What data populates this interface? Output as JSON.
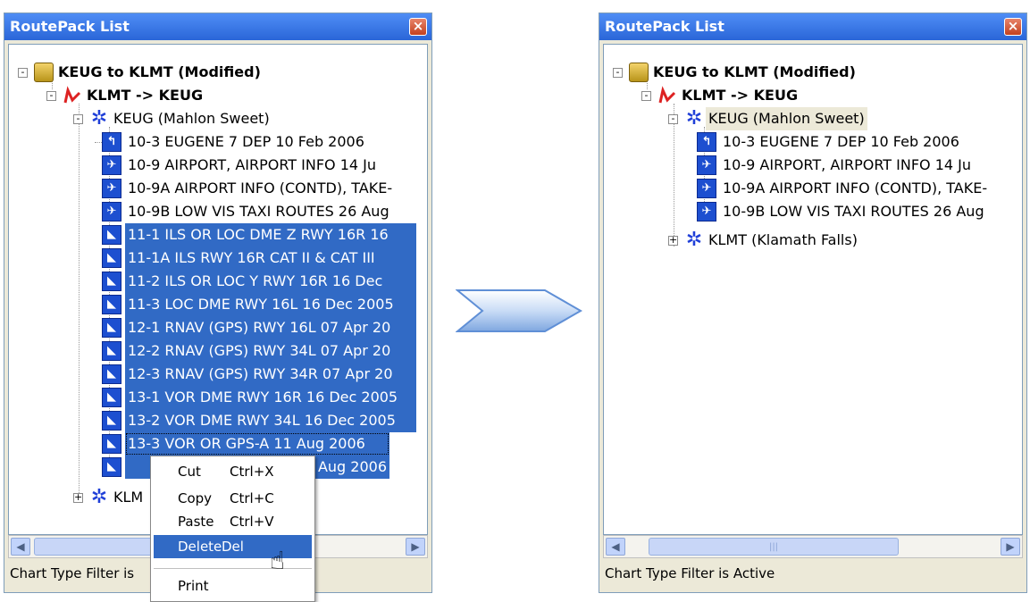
{
  "left_panel": {
    "title": "RoutePack List",
    "status": "Chart Type Filter is",
    "tree": {
      "root": "KEUG to KLMT (Modified)",
      "route": "KLMT -> KEUG",
      "airport1": "KEUG (Mahlon Sweet)",
      "airport2": "KLM",
      "charts": [
        "10-3  EUGENE 7 DEP   10 Feb 2006",
        "10-9  AIRPORT, AIRPORT INFO   14 Ju",
        "10-9A  AIRPORT INFO (CONTD), TAKE-",
        "10-9B  LOW VIS TAXI ROUTES   26 Aug",
        "11-1  ILS OR LOC DME Z RWY 16R   16",
        "11-1A  ILS RWY 16R CAT II & CAT III",
        "11-2  ILS OR LOC Y RWY 16R   16 Dec",
        "11-3  LOC DME RWY 16L   16 Dec 2005",
        "12-1  RNAV (GPS) RWY 16L   07 Apr 20",
        "12-2  RNAV (GPS) RWY 34L   07 Apr 20",
        "12-3  RNAV (GPS) RWY 34R   07 Apr 20",
        "13-1  VOR DME RWY 16R   16 Dec 2005",
        "13-2  VOR DME RWY 34L   16 Dec 2005",
        "13-3  VOR OR GPS-A   11 Aug 2006",
        "1 Aug 2006"
      ]
    }
  },
  "context_menu": {
    "items": [
      {
        "label": "Cut",
        "shortcut": "Ctrl+X"
      },
      {
        "label": "Copy",
        "shortcut": "Ctrl+C"
      },
      {
        "label": "Paste",
        "shortcut": "Ctrl+V"
      },
      {
        "label": "Delete",
        "shortcut": "Del"
      },
      {
        "label": "Print",
        "shortcut": ""
      }
    ]
  },
  "right_panel": {
    "title": "RoutePack List",
    "status": "Chart Type Filter is Active",
    "tree": {
      "root": "KEUG to KLMT (Modified)",
      "route": "KLMT -> KEUG",
      "airport1": "KEUG (Mahlon Sweet)",
      "airport2": "KLMT (Klamath Falls)",
      "charts": [
        "10-3  EUGENE 7 DEP   10 Feb 2006",
        "10-9  AIRPORT, AIRPORT INFO   14 Ju",
        "10-9A  AIRPORT INFO (CONTD), TAKE-",
        "10-9B  LOW VIS TAXI ROUTES   26 Aug"
      ]
    }
  },
  "icons": {
    "close": "close-icon",
    "routepack": "routepack-icon",
    "route": "route-icon",
    "airport": "gear-icon",
    "departure": "departure-chart-icon",
    "airport_chart": "airport-chart-icon",
    "approach": "approach-chart-icon"
  }
}
